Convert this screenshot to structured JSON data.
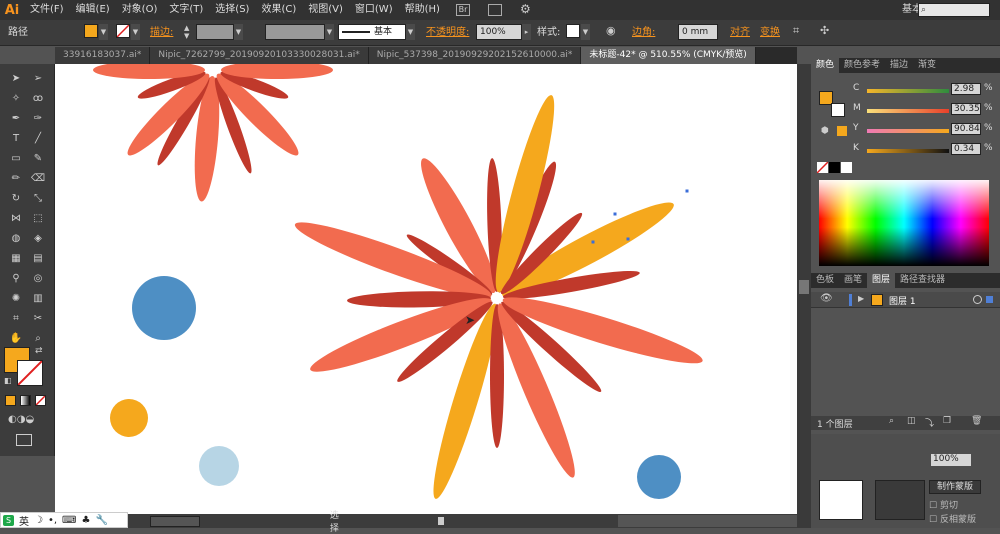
{
  "app": {
    "logo": "Ai"
  },
  "menu": [
    "文件(F)",
    "编辑(E)",
    "对象(O)",
    "文字(T)",
    "选择(S)",
    "效果(C)",
    "视图(V)",
    "窗口(W)",
    "帮助(H)"
  ],
  "workspace": "基本功能",
  "control": {
    "kind": "路径",
    "stroke_label": "描边:",
    "brush_label": "基本",
    "opacity_label": "不透明度:",
    "opacity_value": "100%",
    "style_label": "样式:",
    "corner_label": "边角:",
    "corner_value": "0 mm",
    "align_label": "对齐",
    "transform_label": "变换",
    "fill_color": "#f5a81d"
  },
  "tabs": [
    {
      "label": "33916183037.ai*"
    },
    {
      "label": "Nipic_7262799_20190920103330028031.ai*"
    },
    {
      "label": "Nipic_537398_20190929202152610000.ai*"
    },
    {
      "label": "未标题-42* @ 510.55% (CMYK/预览)",
      "active": true
    }
  ],
  "status": {
    "mode": "选择"
  },
  "ime": {
    "lang": "英"
  },
  "color_panel": {
    "tabs": [
      "颜色",
      "颜色参考",
      "描边",
      "渐变"
    ],
    "C": "2.98",
    "M": "30.35",
    "Y": "90.84",
    "K": "0.34",
    "unit": "%"
  },
  "layers_panel": {
    "tabs": [
      "色板",
      "画笔",
      "图层",
      "路径查找器"
    ],
    "layer_name": "图层 1",
    "count": "1 个图层"
  },
  "appearance_panel": {
    "opacity_value": "100%",
    "make_mask": "制作蒙版",
    "clip": "剪切",
    "invert_mask": "反相蒙版"
  },
  "colors": {
    "orange": "#f26b4f",
    "red": "#c0392b",
    "yellow": "#f5a81d",
    "blue": "#4e8fc4",
    "lightblue": "#b7d5e5"
  }
}
